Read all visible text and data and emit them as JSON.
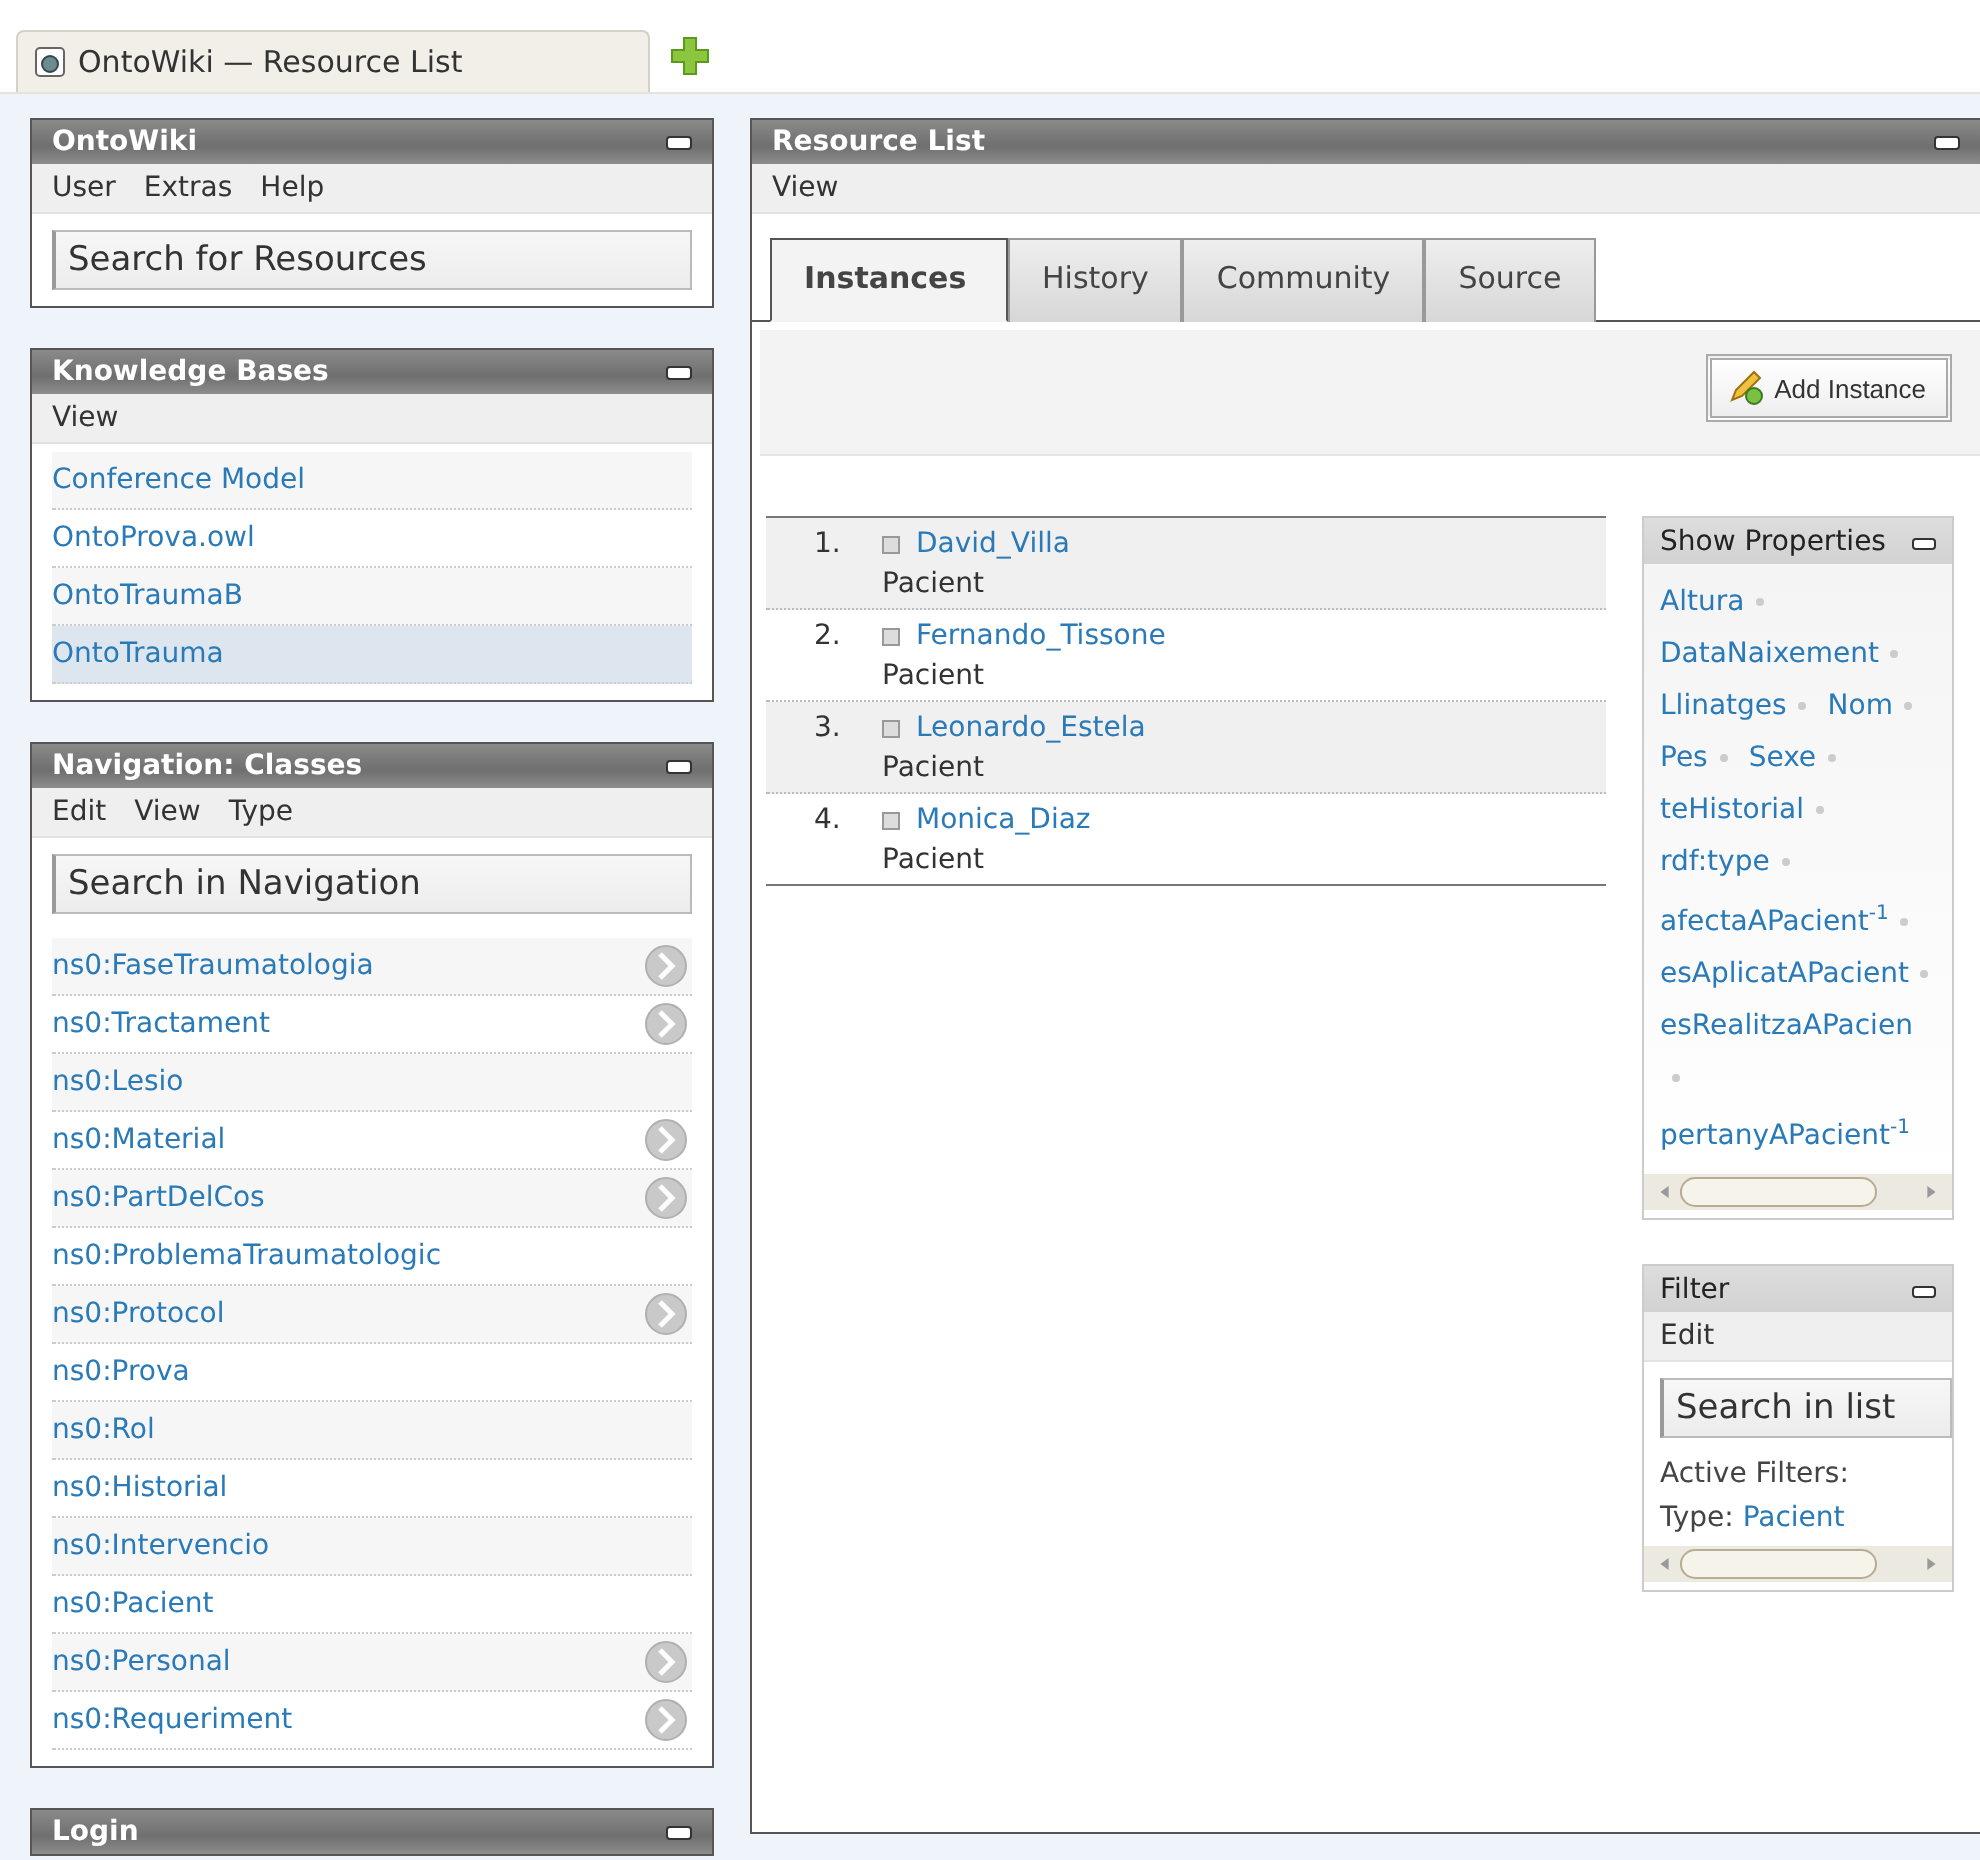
{
  "browser_tab": {
    "title": "OntoWiki — Resource List"
  },
  "sidebar": [
    {
      "title": "OntoWiki",
      "menu": [
        "User",
        "Extras",
        "Help"
      ],
      "search": {
        "placeholder": "Search for Resources"
      }
    },
    {
      "title": "Knowledge Bases",
      "menu": [
        "View"
      ],
      "items": [
        {
          "label": "Conference Model",
          "selected": false
        },
        {
          "label": "OntoProva.owl",
          "selected": false
        },
        {
          "label": "OntoTraumaB",
          "selected": false
        },
        {
          "label": "OntoTrauma",
          "selected": true
        }
      ]
    },
    {
      "title": "Navigation: Classes",
      "menu": [
        "Edit",
        "View",
        "Type"
      ],
      "search": {
        "placeholder": "Search in Navigation"
      },
      "items": [
        {
          "label": "ns0:FaseTraumatologia",
          "has_children": true
        },
        {
          "label": "ns0:Tractament",
          "has_children": true
        },
        {
          "label": "ns0:Lesio",
          "has_children": false
        },
        {
          "label": "ns0:Material",
          "has_children": true
        },
        {
          "label": "ns0:PartDelCos",
          "has_children": true
        },
        {
          "label": "ns0:ProblemaTraumatologic",
          "has_children": false
        },
        {
          "label": "ns0:Protocol",
          "has_children": true
        },
        {
          "label": "ns0:Prova",
          "has_children": false
        },
        {
          "label": "ns0:Rol",
          "has_children": false
        },
        {
          "label": "ns0:Historial",
          "has_children": false
        },
        {
          "label": "ns0:Intervencio",
          "has_children": false
        },
        {
          "label": "ns0:Pacient",
          "has_children": false
        },
        {
          "label": "ns0:Personal",
          "has_children": true
        },
        {
          "label": "ns0:Requeriment",
          "has_children": true
        }
      ]
    },
    {
      "title": "Login"
    }
  ],
  "main": {
    "title": "Resource List",
    "menu": [
      "View"
    ],
    "tabs": [
      {
        "label": "Instances",
        "selected": true
      },
      {
        "label": "History",
        "selected": false
      },
      {
        "label": "Community",
        "selected": false
      },
      {
        "label": "Source",
        "selected": false
      }
    ],
    "add_button": "Add Instance",
    "resources": [
      {
        "number": "1.",
        "name": "David_Villa",
        "type": "Pacient"
      },
      {
        "number": "2.",
        "name": "Fernando_Tissone",
        "type": "Pacient"
      },
      {
        "number": "3.",
        "name": "Leonardo_Estela",
        "type": "Pacient"
      },
      {
        "number": "4.",
        "name": "Monica_Diaz",
        "type": "Pacient"
      }
    ],
    "properties": {
      "title": "Show Properties",
      "items": [
        "Altura",
        "DataNaixement",
        "Llinatges",
        "Nom",
        "Pes",
        "Sexe",
        "teHistorial",
        "rdf:type",
        "afectaAPacient$^{-1}$",
        "esAplicatAPacient",
        "esRealitzaAPacien",
        "pertanyAPacient$^{-1}$"
      ]
    },
    "filter": {
      "title": "Filter",
      "menu": [
        "Edit"
      ],
      "search": {
        "placeholder": "Search in list"
      },
      "heading": "Active Filters:",
      "filters": [
        {
          "label": "Type:",
          "value": "Pacient"
        }
      ]
    }
  }
}
